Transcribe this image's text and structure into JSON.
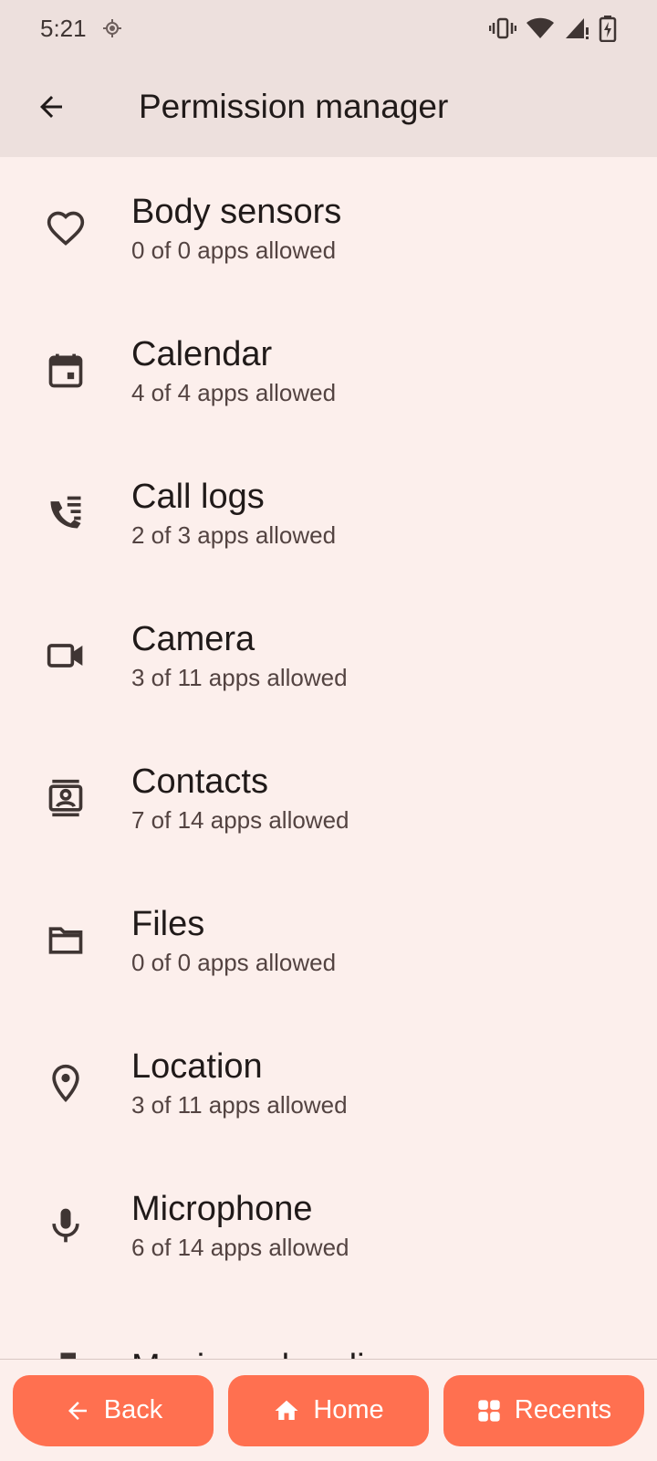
{
  "status_bar": {
    "time": "5:21",
    "icons": [
      "location-icon",
      "vibrate-icon",
      "wifi-icon",
      "signal-icon",
      "battery-charging-icon"
    ]
  },
  "app_bar": {
    "title": "Permission manager",
    "back_icon": "arrow-back-icon"
  },
  "permissions": [
    {
      "label": "Body sensors",
      "summary": "0 of 0 apps allowed",
      "icon": "heart-icon"
    },
    {
      "label": "Calendar",
      "summary": "4 of 4 apps allowed",
      "icon": "calendar-icon"
    },
    {
      "label": "Call logs",
      "summary": "2 of 3 apps allowed",
      "icon": "call-log-icon"
    },
    {
      "label": "Camera",
      "summary": "3 of 11 apps allowed",
      "icon": "camera-icon"
    },
    {
      "label": "Contacts",
      "summary": "7 of 14 apps allowed",
      "icon": "contacts-icon"
    },
    {
      "label": "Files",
      "summary": "0 of 0 apps allowed",
      "icon": "folder-icon"
    },
    {
      "label": "Location",
      "summary": "3 of 11 apps allowed",
      "icon": "location-pin-icon"
    },
    {
      "label": "Microphone",
      "summary": "6 of 14 apps allowed",
      "icon": "microphone-icon"
    },
    {
      "label": "Music and audio",
      "summary": "",
      "icon": "music-icon"
    }
  ],
  "bottom_nav": {
    "back_label": "Back",
    "home_label": "Home",
    "recents_label": "Recents"
  },
  "colors": {
    "background": "#fcefec",
    "app_bar": "#ede0dd",
    "nav_button": "#ff7050"
  }
}
